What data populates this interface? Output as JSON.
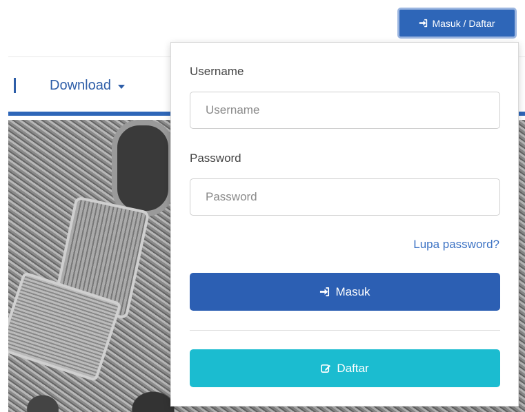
{
  "header": {
    "login_toggle_label": "Masuk / Daftar",
    "login_icon": "sign-in-icon"
  },
  "navbar": {
    "download_label": "Download"
  },
  "login_form": {
    "username_label": "Username",
    "username_placeholder": "Username",
    "password_label": "Password",
    "password_placeholder": "Password",
    "forgot_label": "Lupa password?",
    "login_button_label": "Masuk",
    "register_button_label": "Daftar",
    "register_icon": "edit-icon"
  },
  "colors": {
    "primary": "#2c5fb3",
    "register": "#1bbcd0",
    "link": "#3d73c4"
  }
}
